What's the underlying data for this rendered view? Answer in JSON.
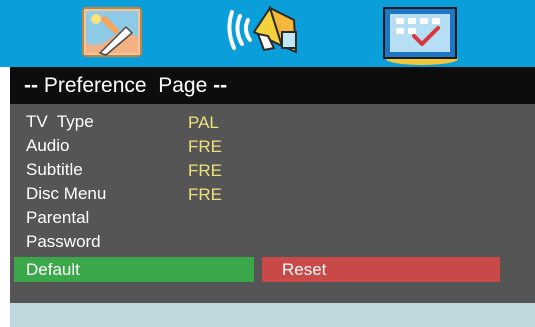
{
  "header": {
    "tabs": [
      {
        "icon": "general-setup-icon"
      },
      {
        "icon": "audio-setup-icon"
      },
      {
        "icon": "preference-setup-icon",
        "selected": true
      }
    ]
  },
  "page": {
    "title_prefix": "--",
    "title": "Preference  Page",
    "title_suffix": "--"
  },
  "menu": {
    "items": [
      {
        "label": "TV  Type",
        "value": "PAL"
      },
      {
        "label": "Audio",
        "value": "FRE"
      },
      {
        "label": "Subtitle",
        "value": "FRE"
      },
      {
        "label": "Disc Menu",
        "value": "FRE"
      },
      {
        "label": "Parental",
        "value": ""
      },
      {
        "label": "Password",
        "value": ""
      },
      {
        "label": "Default",
        "value": "",
        "highlighted": true
      }
    ],
    "reset_label": "Reset"
  },
  "colors": {
    "header_bg": "#0a9edb",
    "menu_bg": "#555555",
    "value_text": "#f0e27a",
    "default_highlight": "#3aa84a",
    "reset_highlight": "#c94848",
    "footer_bg": "#bfd9de"
  }
}
